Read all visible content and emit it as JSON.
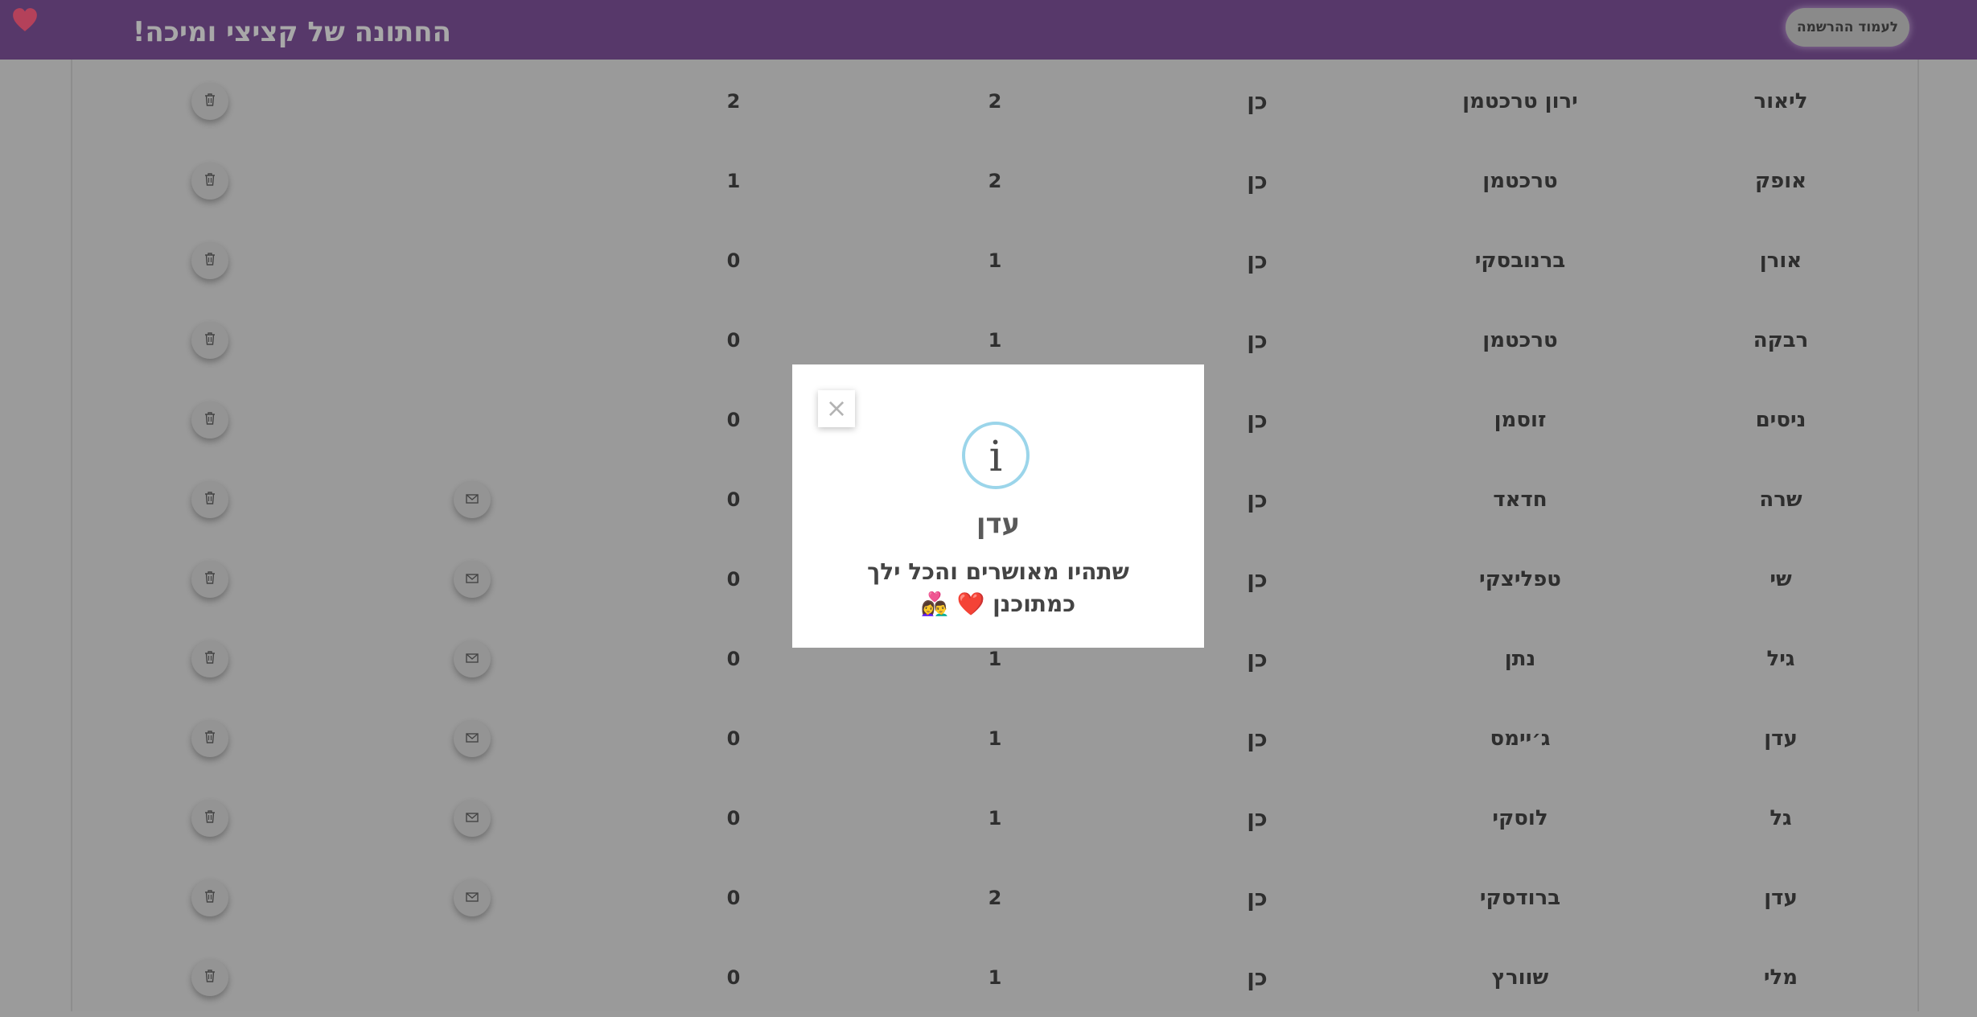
{
  "header": {
    "title": "החתונה של קציצי ומיכה!",
    "register_label": "לעמוד ההרשמה",
    "logo_icon": "heart-icon",
    "brand_color": "#57386a"
  },
  "table": {
    "rows": [
      {
        "first": "ליאור",
        "last": "ירון טרכטמן",
        "attending": "כן",
        "n1": "2",
        "n2": "2",
        "has_mail": false
      },
      {
        "first": "אופק",
        "last": "טרכטמן",
        "attending": "כן",
        "n1": "2",
        "n2": "1",
        "has_mail": false
      },
      {
        "first": "אורן",
        "last": "ברנובסקי",
        "attending": "כן",
        "n1": "1",
        "n2": "0",
        "has_mail": false
      },
      {
        "first": "רבקה",
        "last": "טרכטמן",
        "attending": "כן",
        "n1": "1",
        "n2": "0",
        "has_mail": false
      },
      {
        "first": "ניסים",
        "last": "זוסמן",
        "attending": "כן",
        "n1": "",
        "n2": "0",
        "has_mail": false
      },
      {
        "first": "שרה",
        "last": "חדאד",
        "attending": "כן",
        "n1": "",
        "n2": "0",
        "has_mail": true
      },
      {
        "first": "שי",
        "last": "טפליצקי",
        "attending": "כן",
        "n1": "",
        "n2": "0",
        "has_mail": true
      },
      {
        "first": "גיל",
        "last": "נתן",
        "attending": "כן",
        "n1": "1",
        "n2": "0",
        "has_mail": true
      },
      {
        "first": "עדן",
        "last": "ג׳יימס",
        "attending": "כן",
        "n1": "1",
        "n2": "0",
        "has_mail": true
      },
      {
        "first": "גל",
        "last": "לוסקי",
        "attending": "כן",
        "n1": "1",
        "n2": "0",
        "has_mail": true
      },
      {
        "first": "עדן",
        "last": "ברודסקי",
        "attending": "כן",
        "n1": "2",
        "n2": "0",
        "has_mail": true
      },
      {
        "first": "מלי",
        "last": "שוורץ",
        "attending": "כן",
        "n1": "1",
        "n2": "0",
        "has_mail": false
      }
    ]
  },
  "modal": {
    "close_label": "×",
    "info_symbol": "i",
    "title": "עדן",
    "message": "שתהיו מאושרים והכל ילך כמתוכנן ❤️ 👩‍❤️‍👨"
  }
}
